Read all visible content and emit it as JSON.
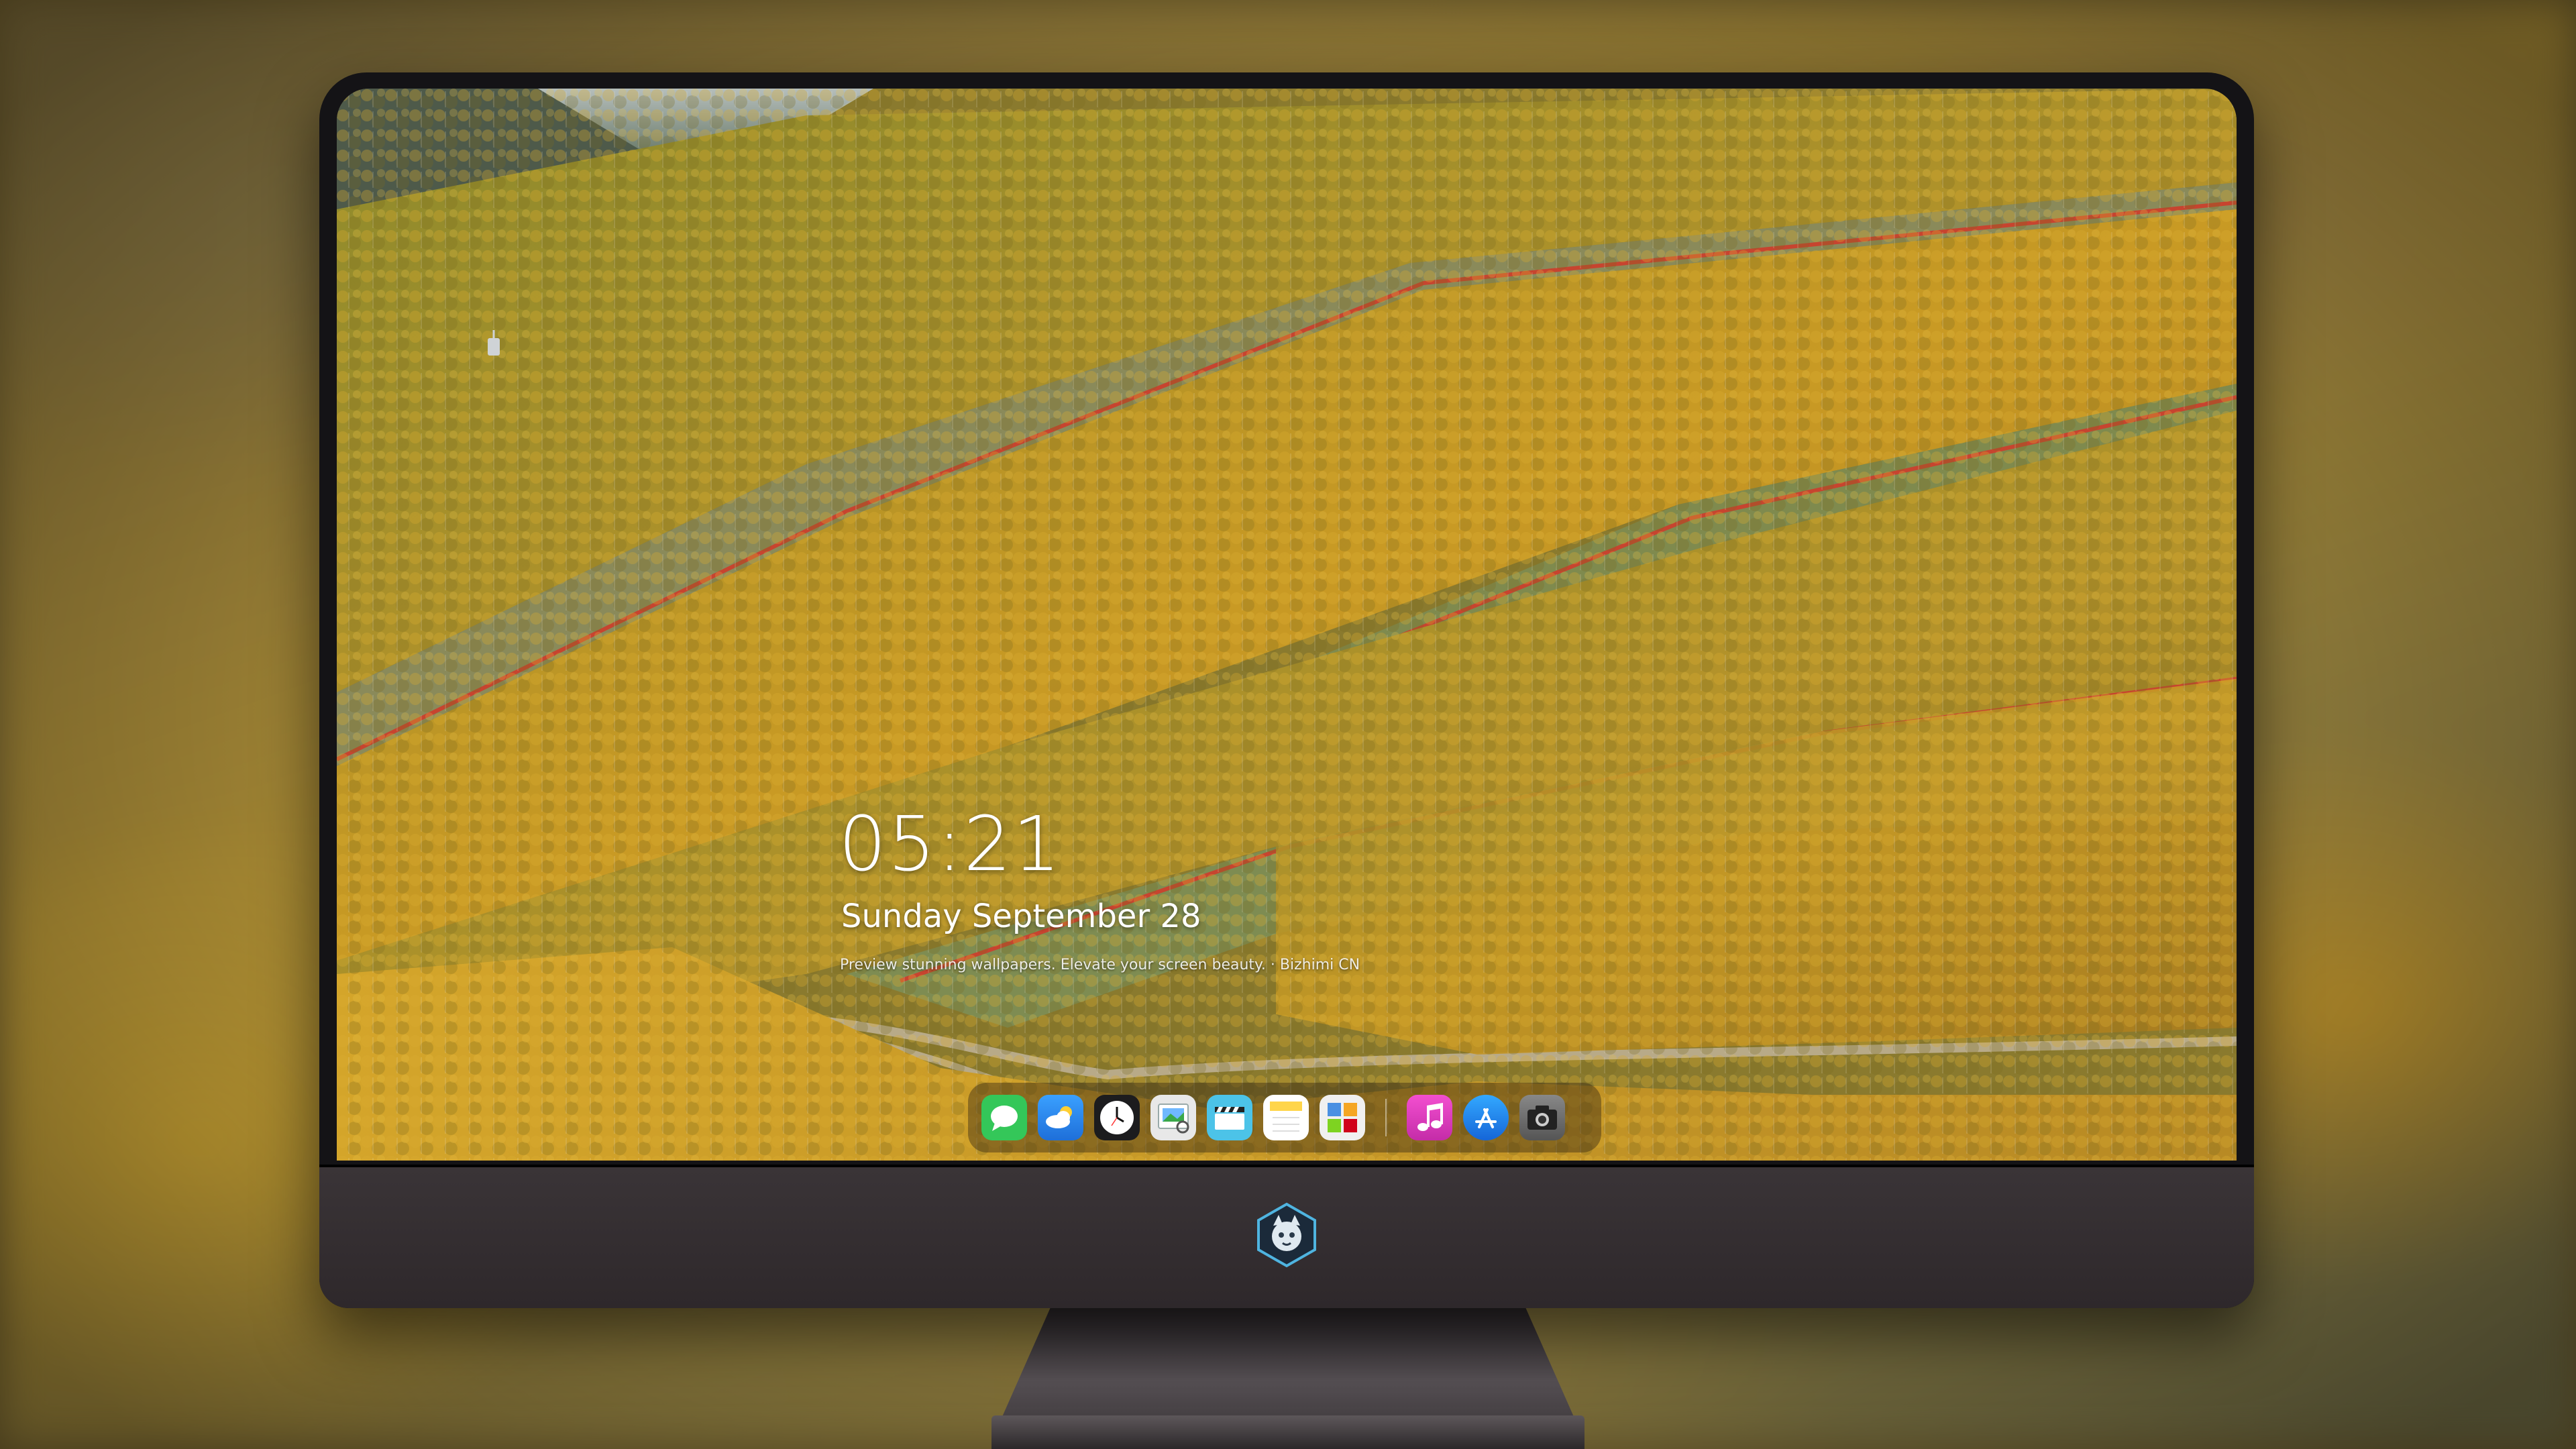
{
  "lockscreen": {
    "time": "05:21",
    "date": "Sunday September 28",
    "tagline": "Preview stunning wallpapers. Elevate your screen beauty.",
    "source": "Bizhimi CN"
  },
  "dock": {
    "apps": [
      {
        "name": "messages",
        "icon": "message-bubble-icon",
        "color": "#34c759"
      },
      {
        "name": "weather",
        "icon": "cloud-icon",
        "color": "#2a8bf2"
      },
      {
        "name": "clock",
        "icon": "clock-icon",
        "color": "#1c1c1e"
      },
      {
        "name": "preview",
        "icon": "preview-icon",
        "color": "#e6e6e6"
      },
      {
        "name": "clips",
        "icon": "clapperboard-icon",
        "color": "#4cc3e8"
      },
      {
        "name": "notes",
        "icon": "notes-icon",
        "color": "#ffd54a"
      },
      {
        "name": "photo-booth",
        "icon": "photos-icon",
        "color": "#f0f0f0"
      },
      {
        "name": "music",
        "icon": "music-note-icon",
        "color": "#e23bbd"
      },
      {
        "name": "app-store",
        "icon": "app-store-icon",
        "color": "#1d8df0"
      },
      {
        "name": "camera",
        "icon": "camera-icon",
        "color": "#5a5a5a"
      }
    ]
  },
  "colors": {
    "bezel": "#141316",
    "chin": "#332d30",
    "foliage": "#c9961f",
    "trail": "#c7442f"
  }
}
